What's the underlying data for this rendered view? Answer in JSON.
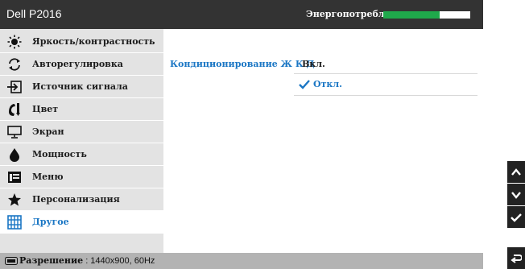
{
  "window": {
    "title": "Dell P2016"
  },
  "energy": {
    "label": "Энергопотребление",
    "level_percent": 65,
    "fill_color": "#1fa84b"
  },
  "sidebar": {
    "items": [
      {
        "label": "Яркость/контрастность",
        "icon": "brightness-icon"
      },
      {
        "label": "Авторегулировка",
        "icon": "auto-adjust-icon"
      },
      {
        "label": "Источник сигнала",
        "icon": "input-source-icon"
      },
      {
        "label": "Цвет",
        "icon": "color-icon"
      },
      {
        "label": "Экран",
        "icon": "display-icon"
      },
      {
        "label": "Мощность",
        "icon": "power-icon"
      },
      {
        "label": "Меню",
        "icon": "menu-icon"
      },
      {
        "label": "Персонализация",
        "icon": "star-icon"
      },
      {
        "label": "Другое",
        "icon": "other-icon",
        "active": true
      }
    ]
  },
  "content": {
    "setting_label": "Кондиционирование Ж К Д",
    "options": [
      {
        "label": "Вкл.",
        "selected": false
      },
      {
        "label": "Откл.",
        "selected": true
      }
    ]
  },
  "status": {
    "resolution_label": "Разрешение",
    "resolution_value": " : 1440x900, 60Hz"
  },
  "nav": {
    "buttons": [
      "up-arrow-icon",
      "down-arrow-icon",
      "check-icon",
      "back-icon"
    ]
  },
  "colors": {
    "accent": "#1a76c4",
    "titlebar": "#333333",
    "sidebar": "#e3e3e3",
    "statusbar": "#b3b3b3"
  }
}
